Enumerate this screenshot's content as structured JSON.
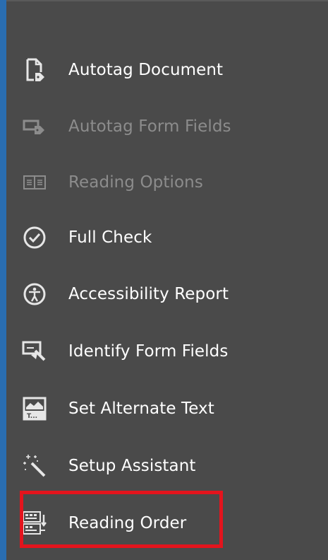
{
  "menu": {
    "items": [
      {
        "label": "Autotag Document",
        "icon": "autotag-document-icon",
        "enabled": true
      },
      {
        "label": "Autotag Form Fields",
        "icon": "autotag-form-fields-icon",
        "enabled": false
      },
      {
        "label": "Reading Options",
        "icon": "reading-options-icon",
        "enabled": false
      },
      {
        "label": "Full Check",
        "icon": "checkmark-circle-icon",
        "enabled": true
      },
      {
        "label": "Accessibility Report",
        "icon": "accessibility-icon",
        "enabled": true
      },
      {
        "label": "Identify Form Fields",
        "icon": "identify-form-fields-icon",
        "enabled": true
      },
      {
        "label": "Set Alternate Text",
        "icon": "alternate-text-icon",
        "enabled": true
      },
      {
        "label": "Setup Assistant",
        "icon": "magic-wand-icon",
        "enabled": true
      },
      {
        "label": "Reading Order",
        "icon": "reading-order-icon",
        "enabled": true,
        "highlighted": true
      }
    ]
  },
  "colors": {
    "background": "#4a4a4a",
    "text": "#ffffff",
    "disabled_text": "#8c8c8c",
    "highlight": "#e3141d",
    "frame": "#2a6db0"
  }
}
